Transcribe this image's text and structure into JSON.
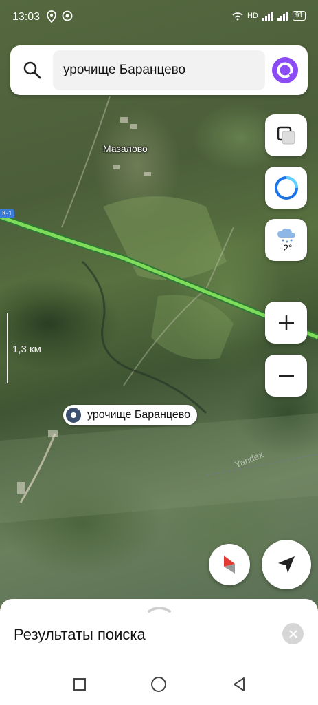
{
  "status_bar": {
    "time": "13:03",
    "network": "HD",
    "battery": "91"
  },
  "search": {
    "query": "урочище Баранцево"
  },
  "map": {
    "place_label": "Мазалово",
    "scale_label": "1,3 км",
    "road_tag": "К-1",
    "poi_label": "урочище Баранцево",
    "watermark": "Yandex"
  },
  "weather": {
    "temperature": "-2°"
  },
  "zoom": {
    "in_label": "+",
    "out_label": "−"
  },
  "bottom_sheet": {
    "title": "Результаты поиска"
  },
  "colors": {
    "accent_purple": "#8c4cf5",
    "road_green": "#7fdc5a",
    "poi_dark": "#3d4f6e"
  }
}
